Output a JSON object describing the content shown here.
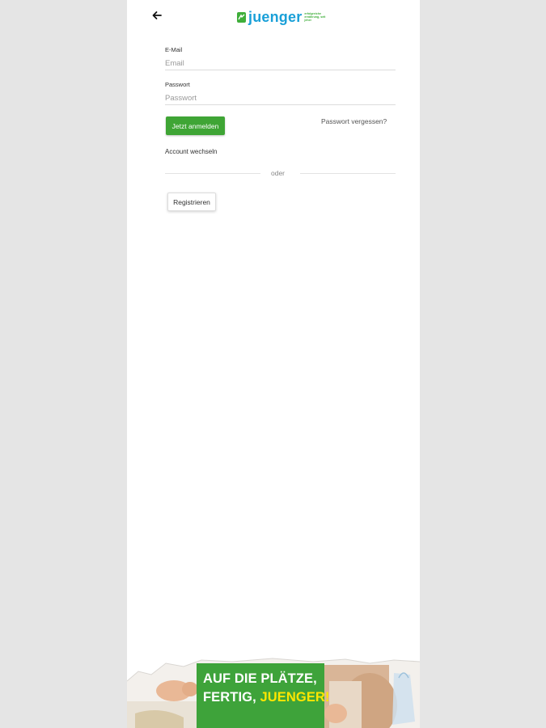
{
  "header": {
    "back_icon": "arrow-left-icon",
    "logo": {
      "wordmark": "juenger",
      "tagline": "erfolgreiche ernährung, seit jeher",
      "brand_green": "#3fae3a",
      "brand_blue": "#1aa0d8"
    }
  },
  "form": {
    "email": {
      "label": "E-Mail",
      "placeholder": "Email",
      "value": ""
    },
    "password": {
      "label": "Passwort",
      "placeholder": "Passwort",
      "value": ""
    },
    "login_button": "Jetzt anmelden",
    "forgot_link": "Passwort vergessen?",
    "switch_account": "Account wechseln",
    "divider_text": "oder",
    "register_button": "Registrieren"
  },
  "banner": {
    "line1": "AUF DIE PLÄTZE,",
    "line2_prefix": "FERTIG, ",
    "line2_accent": "JUENGER!",
    "poster_color": "#3ea33a",
    "accent_color": "#ffe600"
  },
  "colors": {
    "primary_button": "#3fa535",
    "page_background": "#e5e5e5"
  }
}
